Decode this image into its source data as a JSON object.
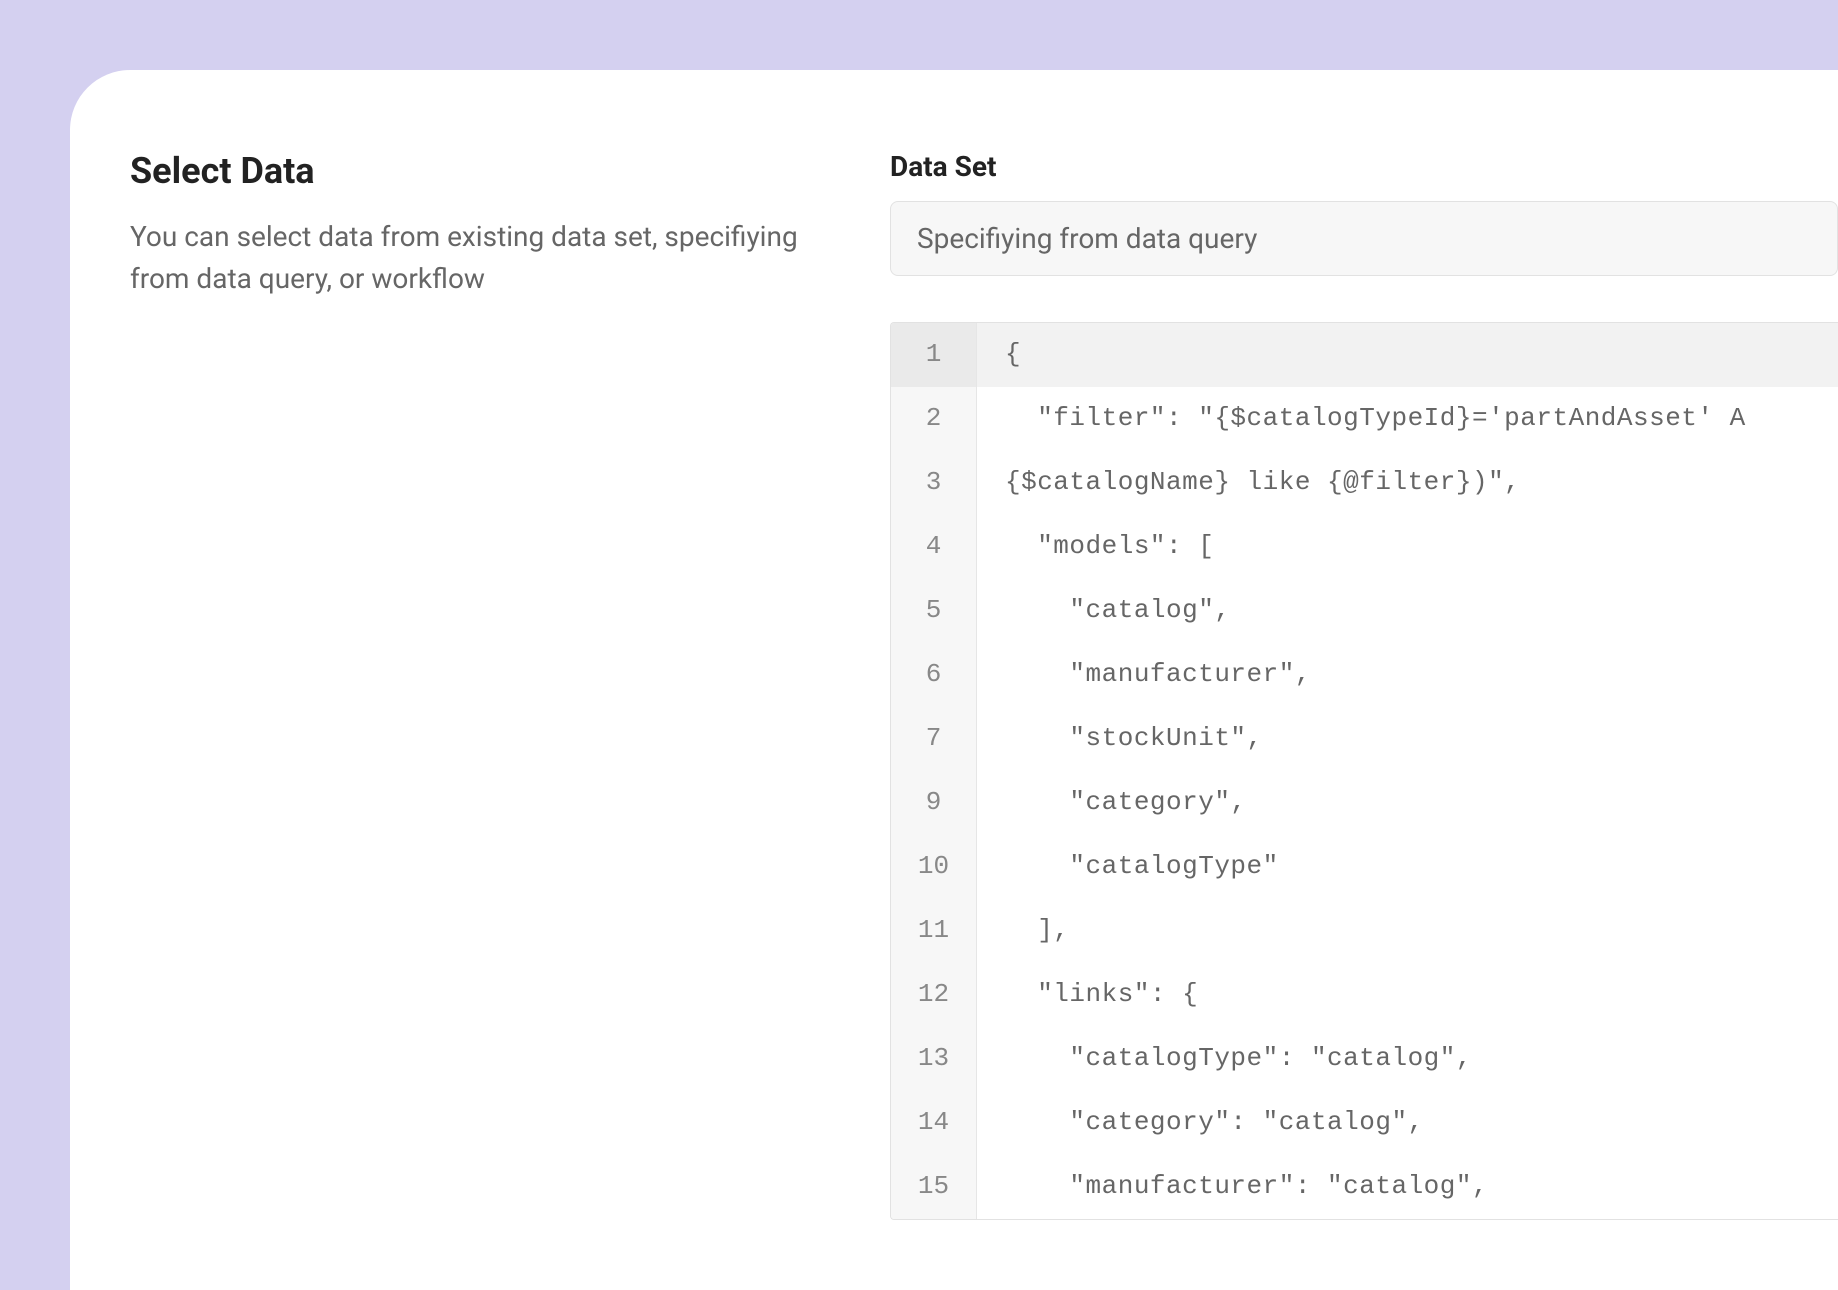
{
  "left": {
    "title": "Select Data",
    "description": "You can select data from existing data set, specifiying from data query, or workflow"
  },
  "right": {
    "field_label": "Data Set",
    "select_value": "Specifiying from data query"
  },
  "editor": {
    "lines": [
      {
        "num": "1",
        "text": "{",
        "highlighted": true
      },
      {
        "num": "2",
        "text": "  \"filter\": \"{$catalogTypeId}='partAndAsset' A",
        "highlighted": false
      },
      {
        "num": "3",
        "text": "{$catalogName} like {@filter})\",",
        "highlighted": false
      },
      {
        "num": "4",
        "text": "  \"models\": [",
        "highlighted": false
      },
      {
        "num": "5",
        "text": "    \"catalog\",",
        "highlighted": false
      },
      {
        "num": "6",
        "text": "    \"manufacturer\",",
        "highlighted": false
      },
      {
        "num": "7",
        "text": "    \"stockUnit\",",
        "highlighted": false
      },
      {
        "num": "9",
        "text": "    \"category\",",
        "highlighted": false
      },
      {
        "num": "10",
        "text": "    \"catalogType\"",
        "highlighted": false
      },
      {
        "num": "11",
        "text": "  ],",
        "highlighted": false
      },
      {
        "num": "12",
        "text": "  \"links\": {",
        "highlighted": false
      },
      {
        "num": "13",
        "text": "    \"catalogType\": \"catalog\",",
        "highlighted": false
      },
      {
        "num": "14",
        "text": "    \"category\": \"catalog\",",
        "highlighted": false
      },
      {
        "num": "15",
        "text": "    \"manufacturer\": \"catalog\",",
        "highlighted": false
      }
    ]
  }
}
